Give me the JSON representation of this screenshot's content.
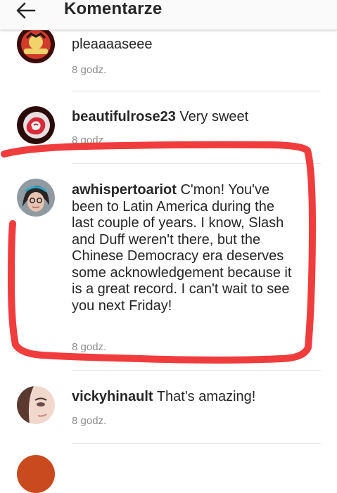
{
  "header": {
    "title": "Komentarze",
    "back_icon": "arrow-left-icon"
  },
  "comments": [
    {
      "username": "",
      "text": "pleaaaaseee",
      "time": "8 godz."
    },
    {
      "username": "beautifulrose23",
      "text": "Very sweet",
      "time": "8 godz."
    },
    {
      "username": "awhispertoariot",
      "text": "C'mon! You've been to Latin America during the last couple of years. I know, Slash and Duff weren't there, but the Chinese Democracy era deserves some acknowledgement because it is a great record. I can't wait to see you next Friday!",
      "time": "8 godz."
    },
    {
      "username": "vickyhinault",
      "text": "That's amazing!",
      "time": "8 godz."
    }
  ],
  "colors": {
    "annotation": "#f03c3c",
    "meta": "#8e8e8e",
    "text": "#262626"
  }
}
